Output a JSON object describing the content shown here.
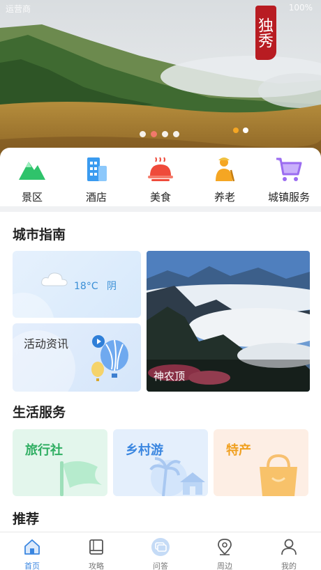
{
  "statusbar": {
    "carrier": "运营商",
    "battery": "100%"
  },
  "banner": {
    "seal_text": "独秀",
    "indicator": {
      "count": 4,
      "active": 1
    }
  },
  "categories": [
    {
      "label": "景区",
      "icon": "mountain-icon",
      "color": "#2fc36b"
    },
    {
      "label": "酒店",
      "icon": "hotel-building-icon",
      "color": "#3a9bf0"
    },
    {
      "label": "美食",
      "icon": "food-cloche-icon",
      "color": "#ef4a3a"
    },
    {
      "label": "养老",
      "icon": "elderly-person-icon",
      "color": "#f5a623"
    },
    {
      "label": "城镇服务",
      "icon": "shopping-cart-icon",
      "color": "#9b6cf0"
    }
  ],
  "city_guide": {
    "title": "城市指南",
    "weather": {
      "temp": "18°C",
      "condition": "阴",
      "icon": "cloud-icon"
    },
    "activity": {
      "label": "活动资讯",
      "icon": "play-circle-icon"
    },
    "scenic": {
      "name": "神农顶",
      "indicator": {
        "count": 2,
        "active": 0
      }
    }
  },
  "life_services": {
    "title": "生活服务",
    "items": [
      {
        "label": "旅行社",
        "color": "#2fae62",
        "bg": "#e3f6ec",
        "icon": "flag-icon"
      },
      {
        "label": "乡村游",
        "color": "#3a86e0",
        "bg": "#e4effc",
        "icon": "palm-house-icon"
      },
      {
        "label": "特产",
        "color": "#f0a020",
        "bg": "#fdeee4",
        "icon": "shopping-bag-icon"
      }
    ]
  },
  "recommend": {
    "title": "推荐"
  },
  "tabbar": [
    {
      "label": "首页",
      "icon": "home-icon",
      "active": true
    },
    {
      "label": "攻略",
      "icon": "book-icon",
      "active": false
    },
    {
      "label": "问答",
      "icon": "qa-chat-icon",
      "active": false
    },
    {
      "label": "周边",
      "icon": "location-pin-icon",
      "active": false
    },
    {
      "label": "我的",
      "icon": "user-icon",
      "active": false
    }
  ]
}
